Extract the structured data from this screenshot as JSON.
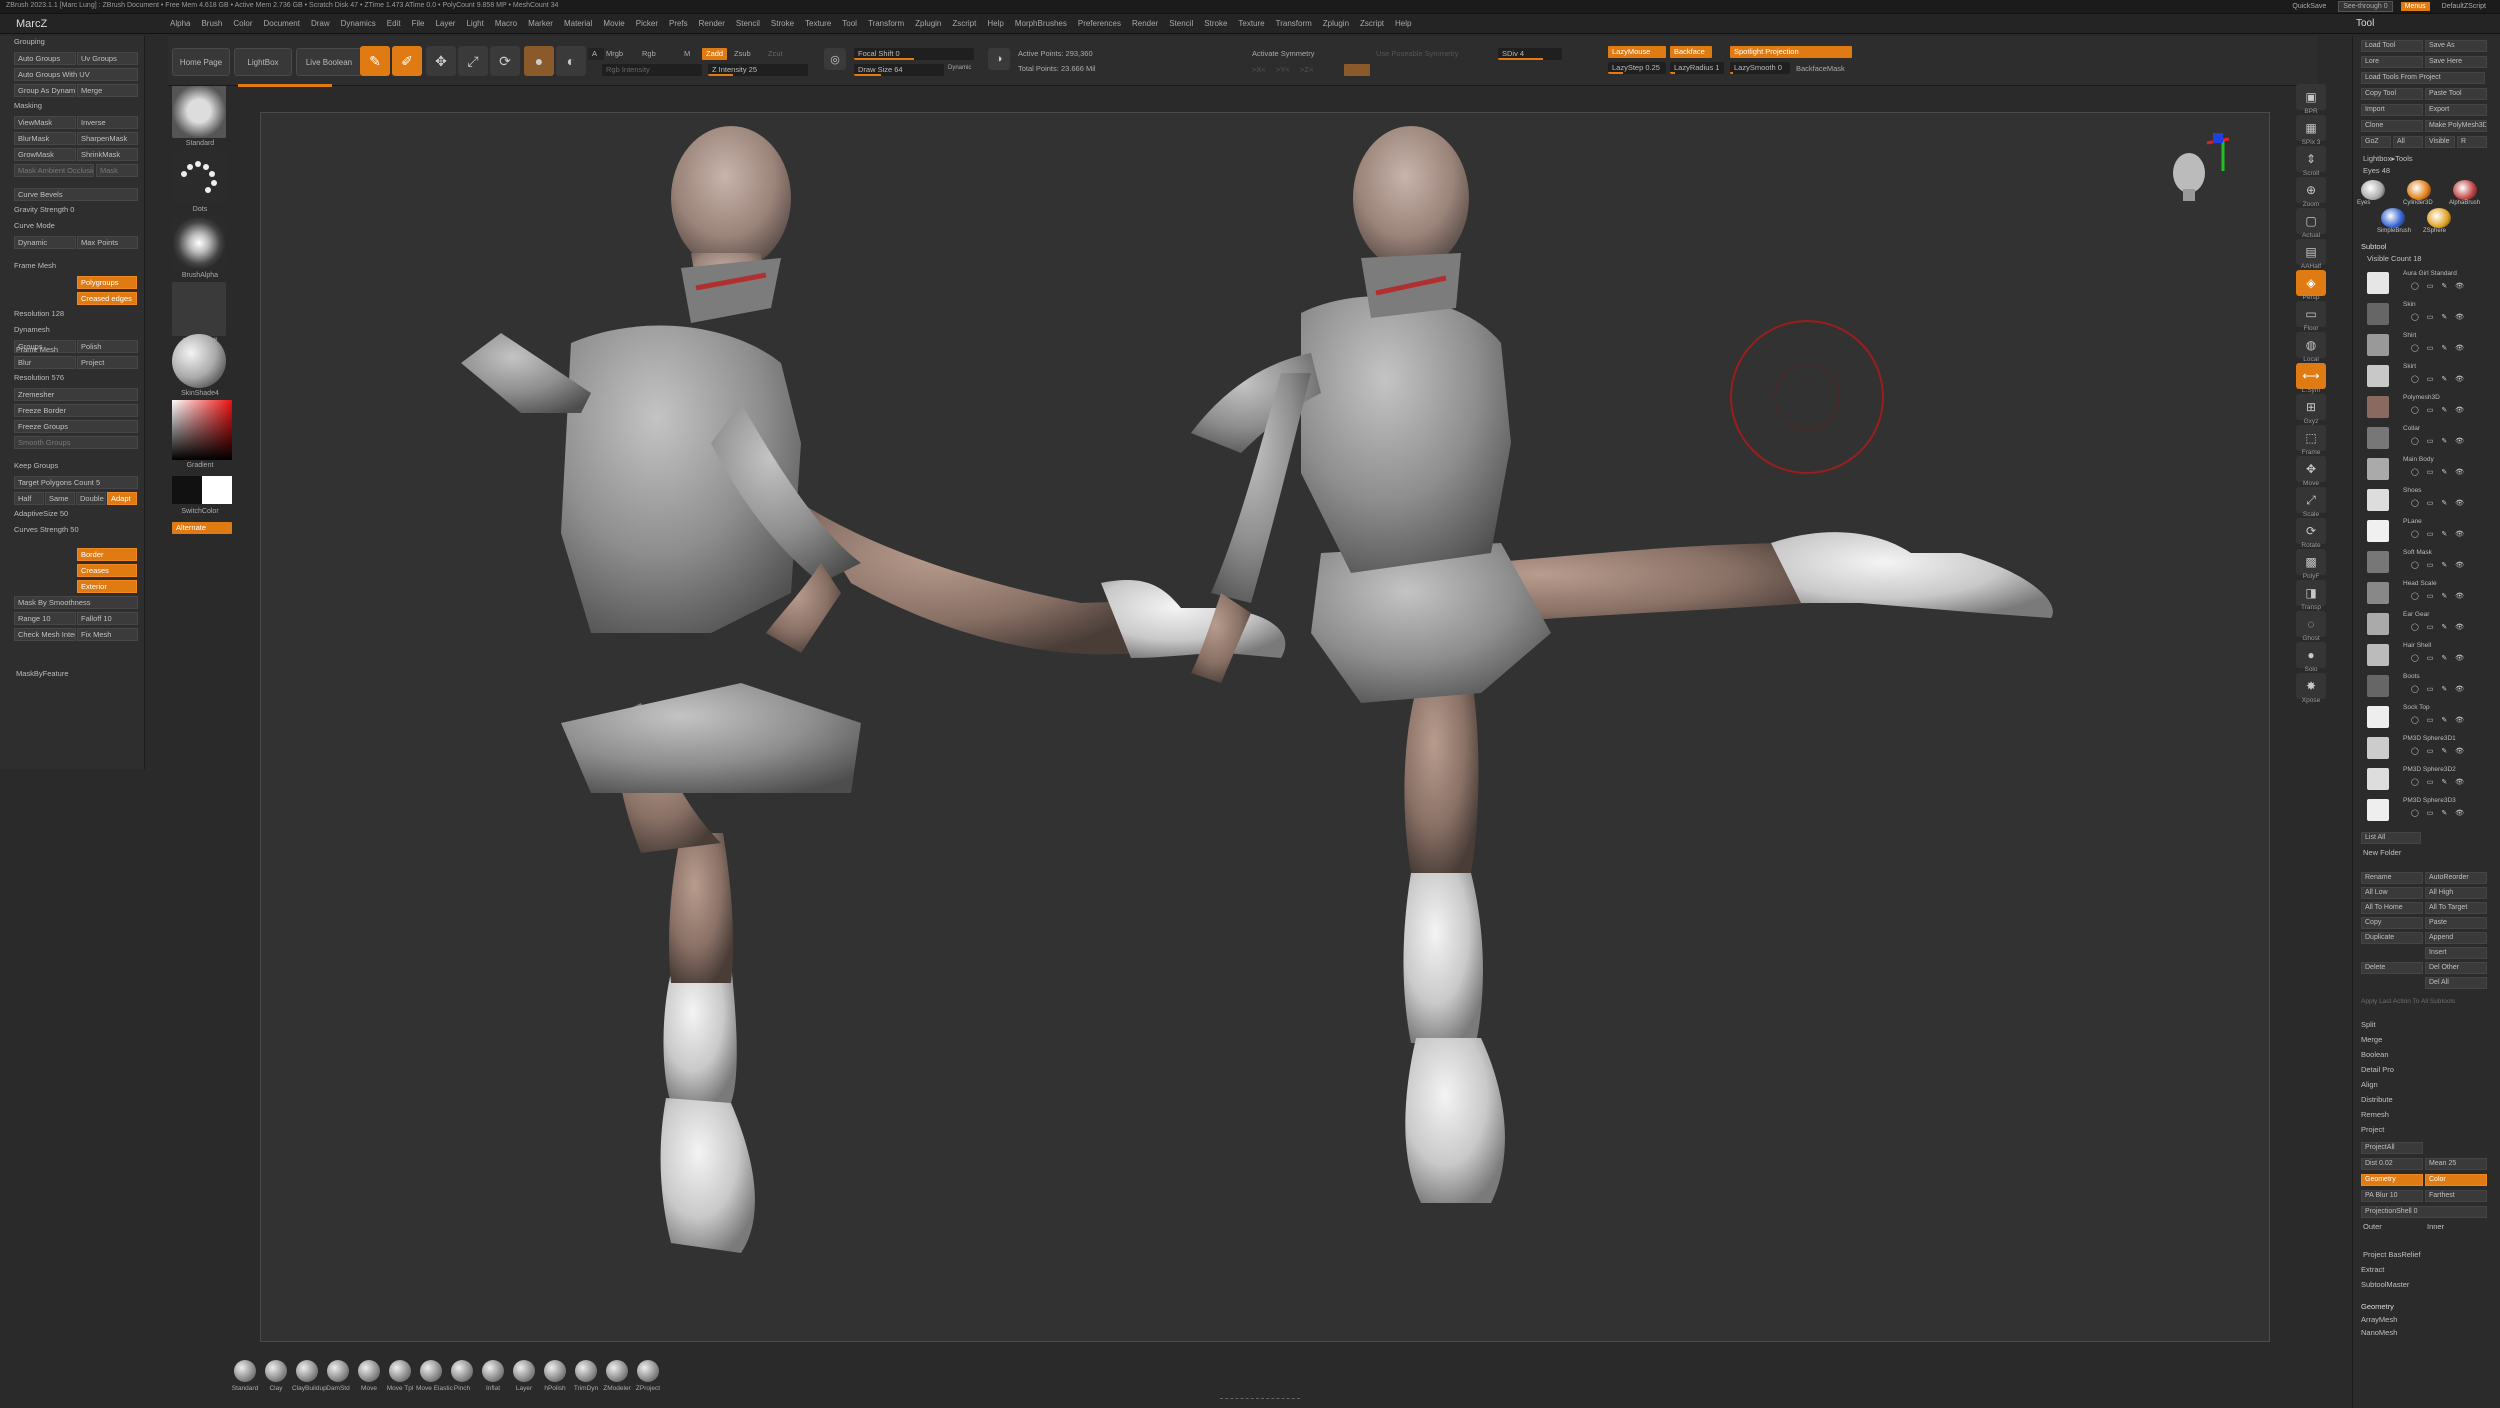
{
  "titlebar": {
    "text": "ZBrush 2023.1.1 [Marc Lung] : ZBrush Document  •  Free Mem 4.618 GB  •  Active Mem 2.736 GB  •  Scratch Disk 47  •  ZTime 1.473  ATime 0.0  •  PolyCount 9.858 MP  •  MeshCount 34",
    "quicksave": "QuickSave",
    "see_through": "See-through 0",
    "menus_chip": "Menus",
    "default_script": "DefaultZScript"
  },
  "menubar": {
    "app": "MarcZ",
    "items": [
      "Alpha",
      "Brush",
      "Color",
      "Document",
      "Draw",
      "Dynamics",
      "Edit",
      "File",
      "Layer",
      "Light",
      "Macro",
      "Marker",
      "Material",
      "Movie",
      "Picker",
      "Prefs",
      "Render",
      "Stencil",
      "Stroke",
      "Texture",
      "Tool",
      "Transform",
      "Zplugin",
      "Zscript",
      "Help",
      "MorphBrushes",
      "Preferences",
      "Render",
      "Stencil",
      "Stroke",
      "Texture",
      "Transform",
      "Zplugin",
      "Zscript",
      "Help"
    ],
    "tool_title": "Tool"
  },
  "shelf": {
    "home_page": "Home Page",
    "lightbox": "LightBox",
    "live_boolean": "Live Boolean",
    "tools": [
      {
        "icon": "edit-icon",
        "label": "Edit"
      },
      {
        "icon": "draw-icon",
        "label": "Draw"
      },
      {
        "icon": "move-icon",
        "label": "Move"
      },
      {
        "icon": "scale-icon",
        "label": "Scale"
      },
      {
        "icon": "rotate-icon",
        "label": "Rotate"
      }
    ],
    "mrgb": "Mrgb",
    "rgb": "Rgb",
    "m": "M",
    "zadd": "Zadd",
    "zsub": "Zsub",
    "zcut": "Zcut",
    "rgb_intensity": "Rgb Intensity",
    "z_intensity": "Z Intensity 25",
    "focal_shift": "Focal Shift 0",
    "draw_size": "Draw Size 64",
    "dynamic": "Dynamic",
    "active_points": "Active Points: 293,360",
    "total_points": "Total Points: 23.666 Mil",
    "symmetry": "Activate Symmetry",
    "sym_x": ">X<",
    "sym_y": ">Y<",
    "sym_z": ">Z<",
    "radial_symmetry": "Use Poseable Symmetry",
    "sdiv": "SDiv 4",
    "lazy_mouse": "LazyMouse",
    "backface": "Backface",
    "spotlight": "Spotlight Projection",
    "lazy_step": "LazyStep 0.25",
    "lazy_radius": "LazyRadius 1",
    "lazy_smooth": "LazySmooth 0",
    "backface_mask": "BackfaceMask"
  },
  "leftpanel": {
    "rows": [
      {
        "t": "Grouping",
        "style": "row"
      },
      {
        "t": "Auto Groups",
        "style": "btn",
        "t2": "Uv Groups"
      },
      {
        "t": "Auto Groups With UV",
        "style": "btn"
      },
      {
        "t": "Group As Dynamesh Sub",
        "style": "btn",
        "t2": "Merge"
      },
      {
        "t": "Masking",
        "style": "row"
      },
      {
        "t": "ViewMask",
        "style": "btn",
        "t2": "Inverse"
      },
      {
        "t": "BlurMask",
        "style": "btn",
        "t2": "SharpenMask"
      },
      {
        "t": "GrowMask",
        "style": "btn",
        "t2": "ShrinkMask"
      },
      {
        "t": "Mask Ambient Occlusion",
        "style": "dim",
        "t2": "Mask"
      },
      {
        "t": "Curve Bevels",
        "style": "btn"
      },
      {
        "t": "Gravity Strength 0",
        "style": "row"
      },
      {
        "t": "Curve Mode",
        "style": "row"
      },
      {
        "t": "Dynamic",
        "style": "btn",
        "t2": "Max Points"
      },
      {
        "t": "Frame Mesh",
        "style": "row"
      },
      {
        "t": "Polygroups",
        "style": "orange"
      },
      {
        "t": "Creased edges",
        "style": "orange"
      },
      {
        "t": "Resolution 128",
        "style": "row"
      },
      {
        "t": "Dynamesh",
        "style": "row"
      },
      {
        "t": "Groups",
        "style": "btn",
        "t2": "Polish"
      },
      {
        "t": "Blur",
        "style": "btn",
        "t2": "Project"
      },
      {
        "t": "Resolution 576",
        "style": "row"
      },
      {
        "t": "Zremesher",
        "style": "btn"
      },
      {
        "t": "Freeze Border",
        "style": "btn"
      },
      {
        "t": "Freeze Groups",
        "style": "btn"
      },
      {
        "t": "Smooth Groups",
        "style": "dim"
      },
      {
        "t": "Keep Groups",
        "style": "row"
      },
      {
        "t": "Target Polygons Count 5",
        "style": "btn"
      },
      {
        "t": "Half",
        "style": "btn",
        "t2": "Same",
        "t3": "Double",
        "t4": "Adapt"
      },
      {
        "t": "AdaptiveSize 50",
        "style": "row"
      },
      {
        "t": "Curves Strength 50",
        "style": "row"
      },
      {
        "t": "Border",
        "style": "orange"
      },
      {
        "t": "Creases",
        "style": "orange"
      },
      {
        "t": "Exterior",
        "style": "orange"
      },
      {
        "t": "Mask By Smoothness",
        "style": "btn"
      },
      {
        "t": "Range 10",
        "style": "btn",
        "t2": "Falloff 10"
      },
      {
        "t": "Check Mesh Integrity",
        "style": "btn",
        "t2": "Fix Mesh"
      }
    ],
    "mask_by_feature": "MaskByFeature",
    "frame_mesh": "Frame Mesh"
  },
  "brushcol": {
    "items": [
      {
        "label": "Standard"
      },
      {
        "label": "Dots"
      },
      {
        "label": "BrushAlpha"
      },
      {
        "label": "Texture Off"
      },
      {
        "label": "SkinShade4"
      },
      {
        "label": "Gradient"
      },
      {
        "label": "SwitchColor"
      },
      {
        "label": "Alternate"
      }
    ]
  },
  "rtool": {
    "items": [
      "BPR",
      "SPix 3",
      "Scroll",
      "Zoom",
      "Actual",
      "AAHalf",
      "Persp",
      "Floor",
      "Local",
      "L.Sym",
      "Gxyz",
      "Frame",
      "Move",
      "Scale",
      "Rotate",
      "PolyF",
      "Transp",
      "Ghost",
      "Solo",
      "Xpose"
    ]
  },
  "rightpanel": {
    "top_buttons": [
      [
        "Load Tool",
        "Save As"
      ],
      [
        "Lore",
        "Save Here"
      ],
      [
        "Load Tools From Project"
      ],
      [
        "Copy Tool",
        "Paste Tool"
      ],
      [
        "Import",
        "Export"
      ],
      [
        "Clone",
        "Make PolyMesh3D"
      ],
      [
        "GoZ",
        "All",
        "Visible",
        "R"
      ]
    ],
    "lightbox_tools": "Lightbox▸Tools",
    "tool_name": "Eyes 48",
    "tool_thumbs": [
      "Eyes",
      "Cylinder3D",
      "AlphaBrush",
      "SimpleBrush",
      "ZSphere"
    ],
    "subtool_header": "Subtool",
    "visible_count": "Visible Count 18",
    "subtools": [
      "Aura Girl Standard",
      "Skin",
      "Shirt",
      "Skirt",
      "Polymesh3D",
      "Collar",
      "Main Body",
      "Shoes",
      "PLane",
      "Soft Mask",
      "Head Scale",
      "Ear Gear",
      "Hair Shell",
      "Boots",
      "Sock Top",
      "PM3D Sphere3D1",
      "PM3D Sphere3D2",
      "PM3D Sphere3D3"
    ],
    "list_all": "List All",
    "new_folder": "New Folder",
    "actions": [
      [
        "Rename",
        "AutoReorder"
      ],
      [
        "All Low",
        "All High"
      ],
      [
        "All To Home",
        "All To Target"
      ],
      [
        "Copy",
        "Paste"
      ],
      [
        "Duplicate",
        "Append"
      ],
      [
        "",
        "Insert"
      ],
      [
        "Delete",
        "Del Other"
      ],
      [
        "",
        "Del All"
      ]
    ],
    "apply_last": "Apply Last Action To All Subtools",
    "sections": [
      "Split",
      "Merge",
      "Boolean",
      "Detail Pro",
      "Align",
      "Distribute",
      "Remesh",
      "Project"
    ],
    "project_all": "ProjectAll",
    "dist": "Dist 0.02",
    "mean": "Mean 25",
    "geometry_chip": "Geometry",
    "color_chip": "Color",
    "pa_blur": "PA Blur 10",
    "farthest": "Farthest",
    "projection_shell": "ProjectionShell 0",
    "outer": "Outer",
    "inner": "Inner",
    "project_bas_relief": "Project BasRelief",
    "extract": "Extract",
    "subtool_master": "SubtoolMaster",
    "geometry": "Geometry",
    "array_mesh": "ArrayMesh",
    "nano_mesh": "NanoMesh"
  },
  "bottomtray": {
    "items": [
      "Standard",
      "Clay",
      "ClayBuildup",
      "DamStd",
      "Move",
      "Move Tpl",
      "Move Elastic",
      "Pinch",
      "Inflat",
      "Layer",
      "hPolish",
      "TrimDyn",
      "ZModeler",
      "ZProject"
    ]
  }
}
